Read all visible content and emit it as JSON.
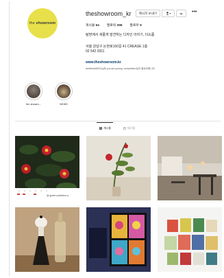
{
  "profile": {
    "username": "theshowroom_kr",
    "logo_text_a": "the ",
    "logo_text_b": "showroom",
    "follow_label": "메시지 보내기",
    "follow_icon": "person-icon",
    "more_label": "•••",
    "stats": [
      {
        "label": "게시물",
        "value": "54"
      },
      {
        "label": "팔로워",
        "value": "396"
      },
      {
        "label": "팔로우",
        "value": "9"
      }
    ],
    "bio_line1": "탐방에서 새롭게 발견하는 디자인 이야기, 더쇼룸",
    "bio_line2": "서울 강남구 논현로150길 41 CREASE 1층",
    "bio_line3": "02 542 3911",
    "website": "www.theshowroom.kr",
    "followed_by": "dwellin&#8203;g와 you.are.young, compilation님이 팔로우합니다"
  },
  "highlights": [
    {
      "label": "the showro...",
      "icon": "showroom-highlight"
    },
    {
      "label": "NEWS",
      "icon": "news-highlight"
    }
  ],
  "tabs": [
    {
      "label": "게시물",
      "icon": "grid-icon",
      "active": true
    },
    {
      "label": "태그됨",
      "icon": "tag-icon",
      "active": false
    }
  ],
  "posts": [
    {
      "name": "red-camellia-post",
      "caption": "@ green.collection.a"
    },
    {
      "name": "plant-vase-post",
      "caption": ""
    },
    {
      "name": "cafe-interior-post",
      "caption": ""
    },
    {
      "name": "bottle-opener-post",
      "caption": ""
    },
    {
      "name": "warhol-poster-post",
      "caption": ""
    },
    {
      "name": "tin-boxes-post",
      "caption": ""
    }
  ]
}
